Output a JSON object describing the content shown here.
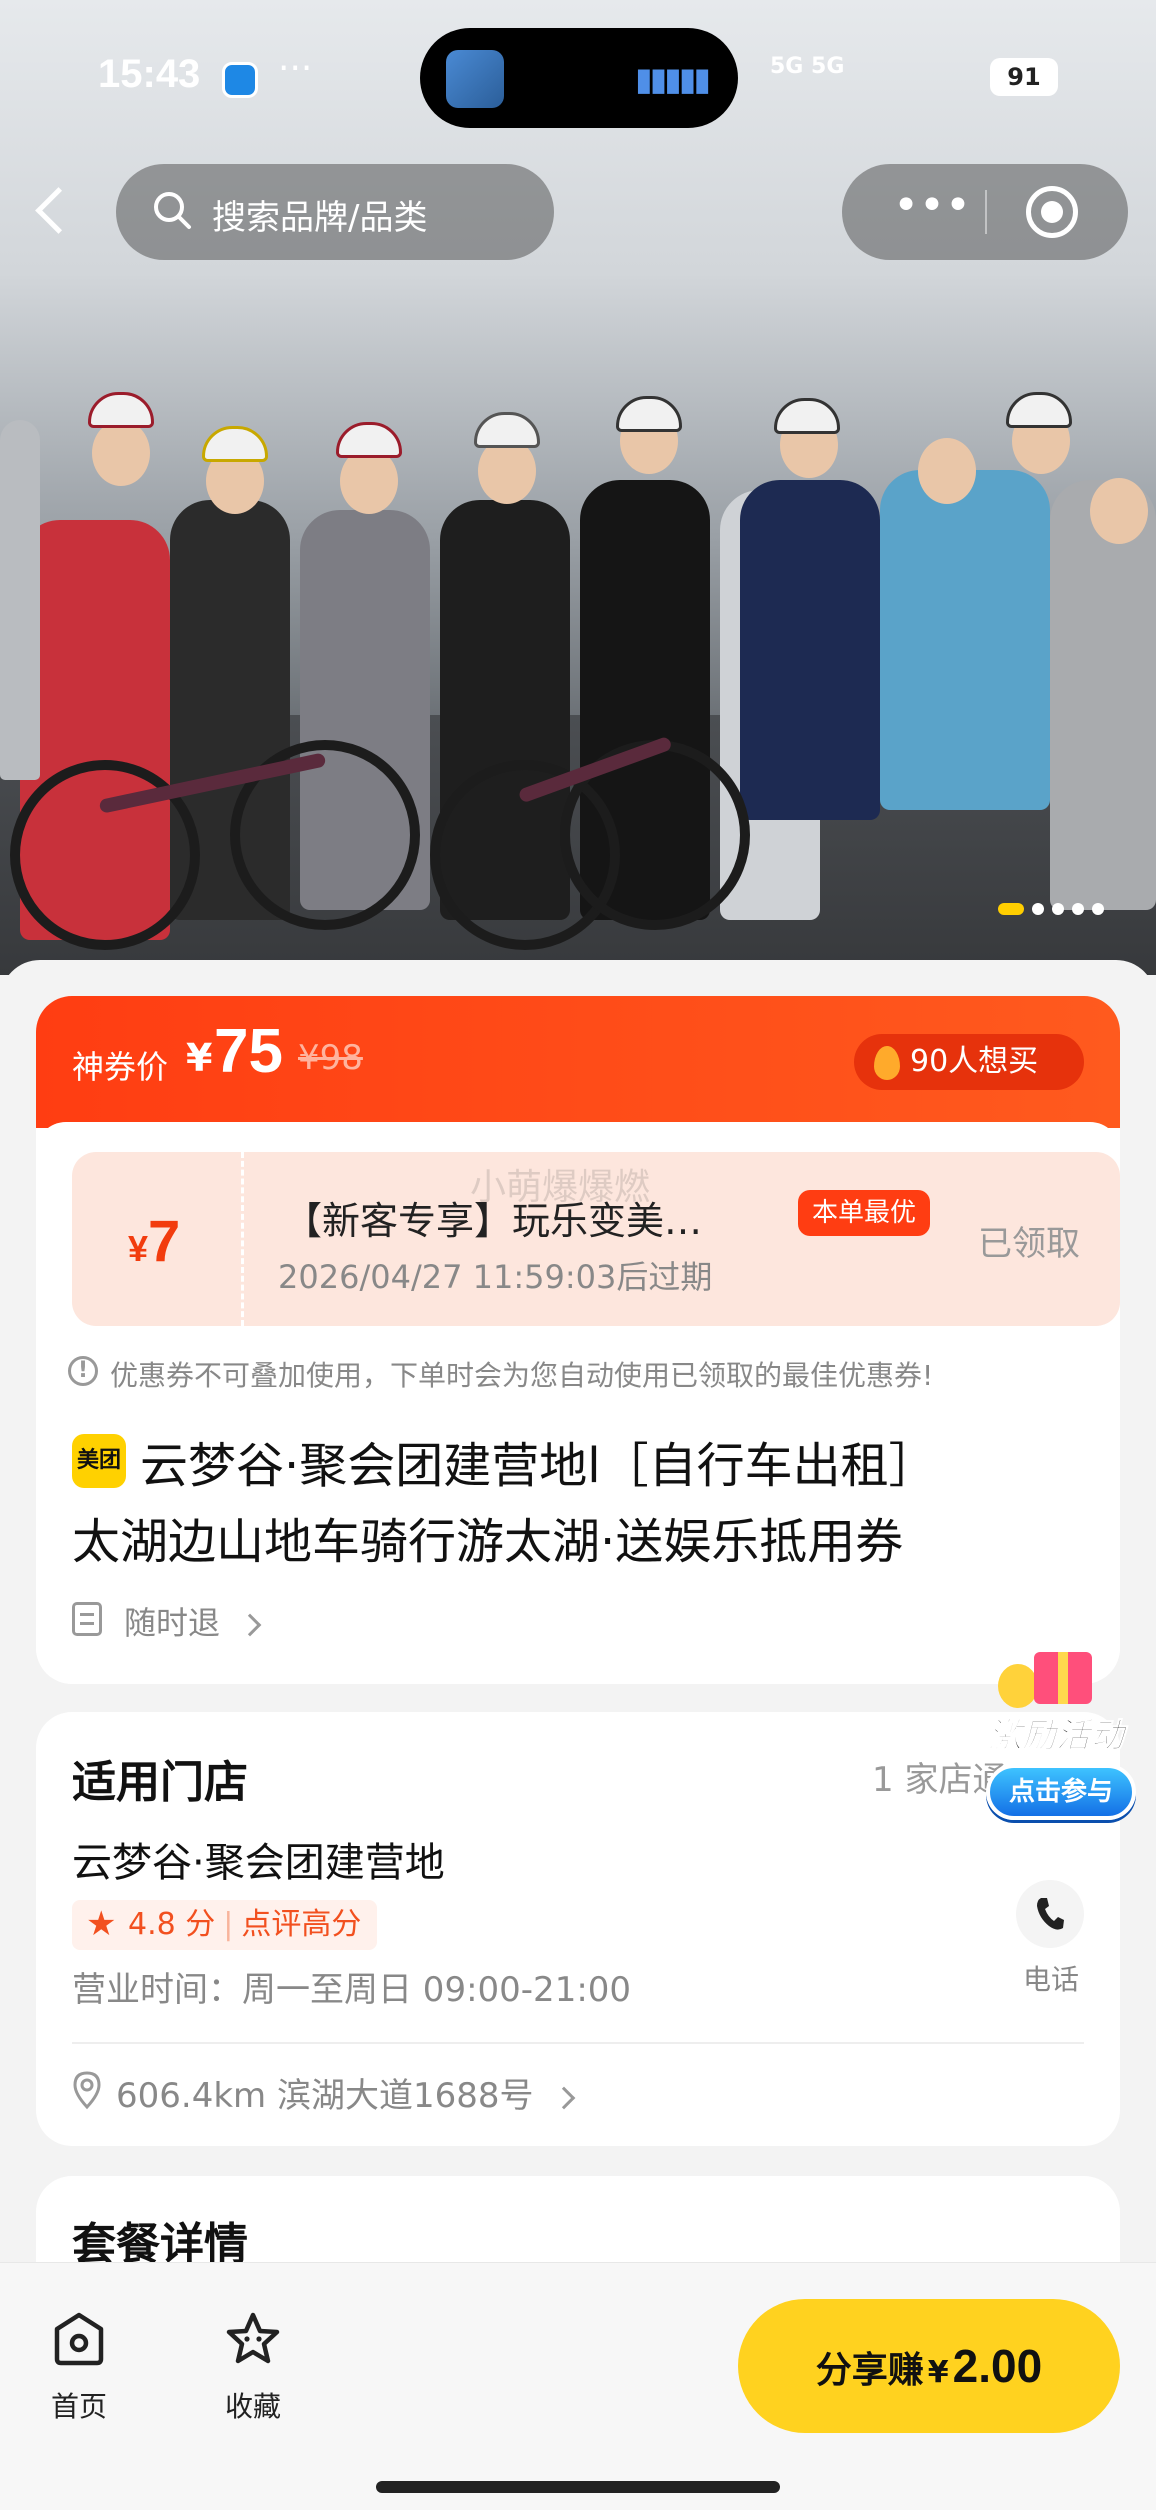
{
  "status_bar": {
    "time": "15:43",
    "dots": "···",
    "network": "5G 5G",
    "battery": "91"
  },
  "nav": {
    "search_placeholder": "搜索品牌/品类",
    "more": "•••"
  },
  "hero": {
    "image_count": 5,
    "active_index": 0
  },
  "price": {
    "label": "神券价",
    "currency": "¥",
    "value": "75",
    "original": "¥98",
    "want_text": "90人想买"
  },
  "coupon": {
    "currency": "¥",
    "amount": "7",
    "title": "【新客专享】玩乐变美…",
    "best_badge": "本单最优",
    "expire": "2026/04/27 11:59:03后过期",
    "state": "已领取"
  },
  "notice": {
    "icon": "!",
    "text": "优惠券不可叠加使用，下单时会为您自动使用已领取的最佳优惠券!"
  },
  "deal": {
    "logo_text": "美团",
    "title_line1": "云梦谷·聚会团建营地l［自行车出租］",
    "title_line2": "太湖边山地车骑行游太湖·送娱乐抵用券",
    "refund_text": "随时退"
  },
  "store": {
    "heading": "适用门店",
    "count_text": "1 家店通用",
    "name": "云梦谷·聚会团建营地",
    "rating_star": "★",
    "rating_text": "4.8 分",
    "rating_tag": "点评高分",
    "rating_divider": "|",
    "hours": "营业时间：周一至周日 09:00-21:00",
    "phone_label": "电话",
    "distance_addr": "606.4km   滨湖大道1688号"
  },
  "detail": {
    "heading": "套餐详情"
  },
  "activity": {
    "title": "激励活动",
    "button": "点击参与"
  },
  "bottom_bar": {
    "home_label": "首页",
    "favorite_label": "收藏",
    "share_label": "分享赚",
    "share_currency": "¥",
    "share_amount": "2.00"
  },
  "watermark": "小萌爆爆燃",
  "colors": {
    "accent": "#ff3d12",
    "yellow": "#ffd21f",
    "coupon_bg": "#fde6dd"
  }
}
